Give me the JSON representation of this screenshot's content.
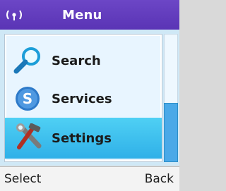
{
  "header": {
    "title": "Menu",
    "signal_icon": "signal-icon"
  },
  "menu": {
    "items": [
      {
        "label": "Search",
        "icon": "magnifier-icon",
        "selected": false
      },
      {
        "label": "Services",
        "icon": "services-icon",
        "selected": false
      },
      {
        "label": "Settings",
        "icon": "tools-icon",
        "selected": true
      }
    ]
  },
  "softkeys": {
    "left": "Select",
    "right": "Back"
  },
  "colors": {
    "title_bar": "#5a34b5",
    "selection": "#2fb0e8"
  }
}
